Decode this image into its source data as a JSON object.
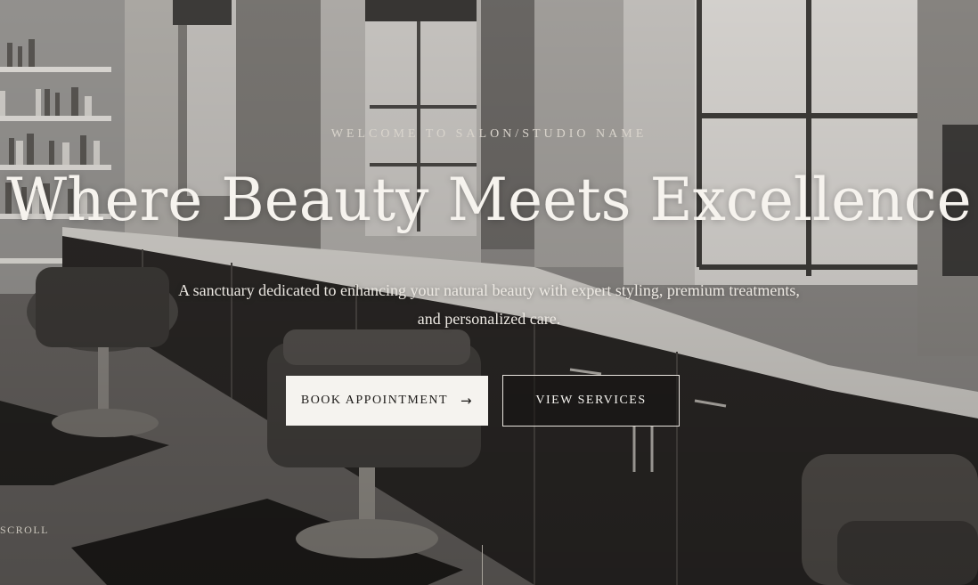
{
  "hero": {
    "eyebrow": "WELCOME TO SALON/STUDIO NAME",
    "headline": "Where Beauty Meets Excellence",
    "subtitle": "A sanctuary dedicated to enhancing your natural beauty with expert styling, premium treatments, and personalized care.",
    "primary_button": {
      "label": "BOOK APPOINTMENT",
      "icon": "arrow-right-icon"
    },
    "secondary_button": {
      "label": "VIEW SERVICES"
    },
    "scroll_label": "SCROLL"
  },
  "colors": {
    "text_light": "#f4f1ec",
    "button_light_bg": "#f5f3ef",
    "button_dark_text": "#1d1b19"
  }
}
